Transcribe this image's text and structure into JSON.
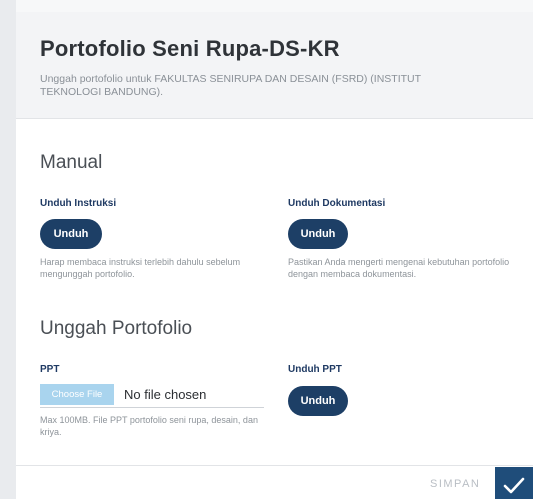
{
  "modal": {
    "title": "Portofolio Seni Rupa-DS-KR",
    "subtitle": "Unggah portofolio untuk FAKULTAS SENIRUPA DAN DESAIN (FSRD) (INSTITUT TEKNOLOGI BANDUNG)."
  },
  "manual": {
    "section_title": "Manual",
    "instruksi": {
      "label": "Unduh Instruksi",
      "button": "Unduh",
      "help": "Harap membaca instruksi terlebih dahulu sebelum mengunggah portofolio."
    },
    "dokumentasi": {
      "label": "Unduh Dokumentasi",
      "button": "Unduh",
      "help": "Pastikan Anda mengerti mengenai kebutuhan portofolio dengan membaca dokumentasi."
    }
  },
  "upload": {
    "section_title": "Unggah Portofolio",
    "ppt": {
      "label": "PPT",
      "choose_file": "Choose File",
      "file_status": "No file chosen",
      "help": "Max 100MB. File PPT portofolio seni rupa, desain, dan kriya."
    },
    "unduh_ppt": {
      "label": "Unduh PPT",
      "button": "Unduh"
    }
  },
  "footer": {
    "save_label": "SIMPAN",
    "confirm_icon": "checkmark-icon"
  },
  "colors": {
    "primary": "#1d3f66",
    "confirm": "#1f4d7a",
    "file_button": "#a9d4ee",
    "header_bg": "#f3f4f6"
  }
}
